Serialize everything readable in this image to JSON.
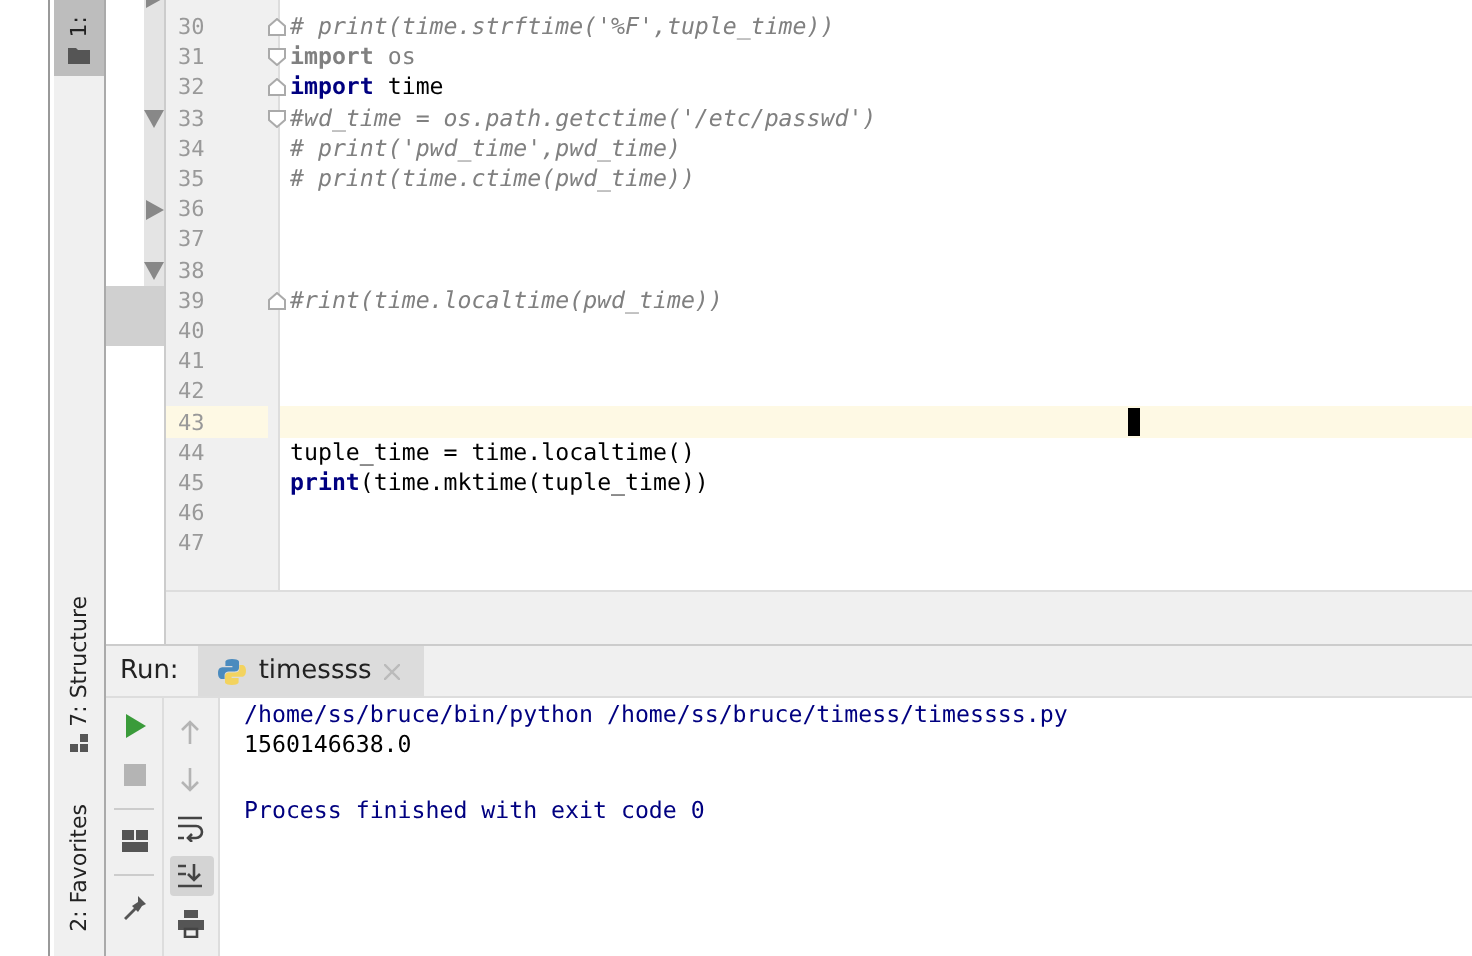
{
  "tool_strip": {
    "tabs": [
      {
        "label": "1:",
        "selected": true,
        "kind": "project"
      },
      {
        "label": "7: Structure",
        "selected": false,
        "kind": "structure"
      },
      {
        "label": "2: Favorites",
        "selected": false,
        "kind": "favorites"
      }
    ]
  },
  "project_panel": {
    "rows": [
      {
        "kind": "arrow",
        "expanded": false,
        "selected": false
      },
      {
        "kind": "blank",
        "selected": false
      },
      {
        "kind": "blank",
        "selected": false
      },
      {
        "kind": "blank",
        "selected": false
      },
      {
        "kind": "arrow",
        "expanded": true,
        "selected": false
      },
      {
        "kind": "blank",
        "selected": false
      },
      {
        "kind": "blank",
        "selected": false
      },
      {
        "kind": "arrow",
        "expanded": false,
        "selected": false
      },
      {
        "kind": "blank",
        "selected": false
      },
      {
        "kind": "arrow",
        "expanded": true,
        "selected": false
      },
      {
        "kind": "blank",
        "selected": true
      },
      {
        "kind": "blank",
        "selected": true
      }
    ]
  },
  "editor": {
    "lines": [
      {
        "number": "30",
        "fold_marker": {
          "kind": "end"
        },
        "current": false,
        "tokens": [
          {
            "kind": "comment",
            "text": "# print(time.strftime('%F',tuple_time))"
          }
        ]
      },
      {
        "number": "31",
        "fold_marker": {
          "kind": "start"
        },
        "current": false,
        "tokens": [
          {
            "kind": "unused",
            "text": "import"
          },
          {
            "kind": "unused-name",
            "text": " os"
          }
        ]
      },
      {
        "number": "32",
        "fold_marker": {
          "kind": "end"
        },
        "current": false,
        "tokens": [
          {
            "kind": "keyword",
            "text": "import"
          },
          {
            "kind": "plain",
            "text": " time"
          }
        ]
      },
      {
        "number": "33",
        "fold_marker": {
          "kind": "start"
        },
        "current": false,
        "tokens": [
          {
            "kind": "comment",
            "text": "#wd_time = os.path.getctime('/etc/passwd')"
          }
        ]
      },
      {
        "number": "34",
        "current": false,
        "tokens": [
          {
            "kind": "comment",
            "text": "# print('pwd_time',pwd_time)"
          }
        ]
      },
      {
        "number": "35",
        "current": false,
        "tokens": [
          {
            "kind": "comment",
            "text": "# print(time.ctime(pwd_time))"
          }
        ]
      },
      {
        "number": "36",
        "current": false
      },
      {
        "number": "37",
        "current": false
      },
      {
        "number": "38",
        "current": false
      },
      {
        "number": "39",
        "fold_marker": {
          "kind": "end"
        },
        "current": false,
        "tokens": [
          {
            "kind": "comment",
            "text": "#rint(time.localtime(pwd_time))"
          }
        ]
      },
      {
        "number": "40",
        "current": false
      },
      {
        "number": "41",
        "current": false
      },
      {
        "number": "42",
        "current": false
      },
      {
        "number": "43",
        "current": true
      },
      {
        "number": "44",
        "current": false,
        "tokens": [
          {
            "kind": "plain",
            "text": "tuple_time = time.localtime()"
          }
        ]
      },
      {
        "number": "45",
        "current": false,
        "tokens": [
          {
            "kind": "keyword",
            "text": "print"
          },
          {
            "kind": "plain",
            "text": "(time.mktime(tuple_time))"
          }
        ]
      },
      {
        "number": "46",
        "current": false
      },
      {
        "number": "47",
        "current": false
      }
    ]
  },
  "run_panel": {
    "label": "Run:",
    "tabs": [
      {
        "label": "timessss",
        "selected": true
      }
    ],
    "toolbar": [
      {
        "kind": "run",
        "disabled": false
      },
      {
        "kind": "stop",
        "disabled": true
      },
      {
        "kind": "layout",
        "disabled": false
      },
      {
        "kind": "pin",
        "disabled": false
      }
    ],
    "toolbar_2": [
      {
        "kind": "up",
        "disabled": true,
        "selected": false
      },
      {
        "kind": "down",
        "disabled": true,
        "selected": false
      },
      {
        "kind": "wrap",
        "disabled": false,
        "selected": false
      },
      {
        "kind": "scroll-end",
        "disabled": false,
        "selected": true
      },
      {
        "kind": "print",
        "disabled": false,
        "selected": false
      }
    ],
    "console": [
      {
        "kind": "system",
        "text": "/home/ss/bruce/bin/python /home/ss/bruce/timess/timessss.py"
      },
      {
        "kind": "output",
        "text": "1560146638.0"
      },
      {
        "kind": "blank"
      },
      {
        "kind": "system",
        "text": "Process finished with exit code 0"
      }
    ]
  }
}
